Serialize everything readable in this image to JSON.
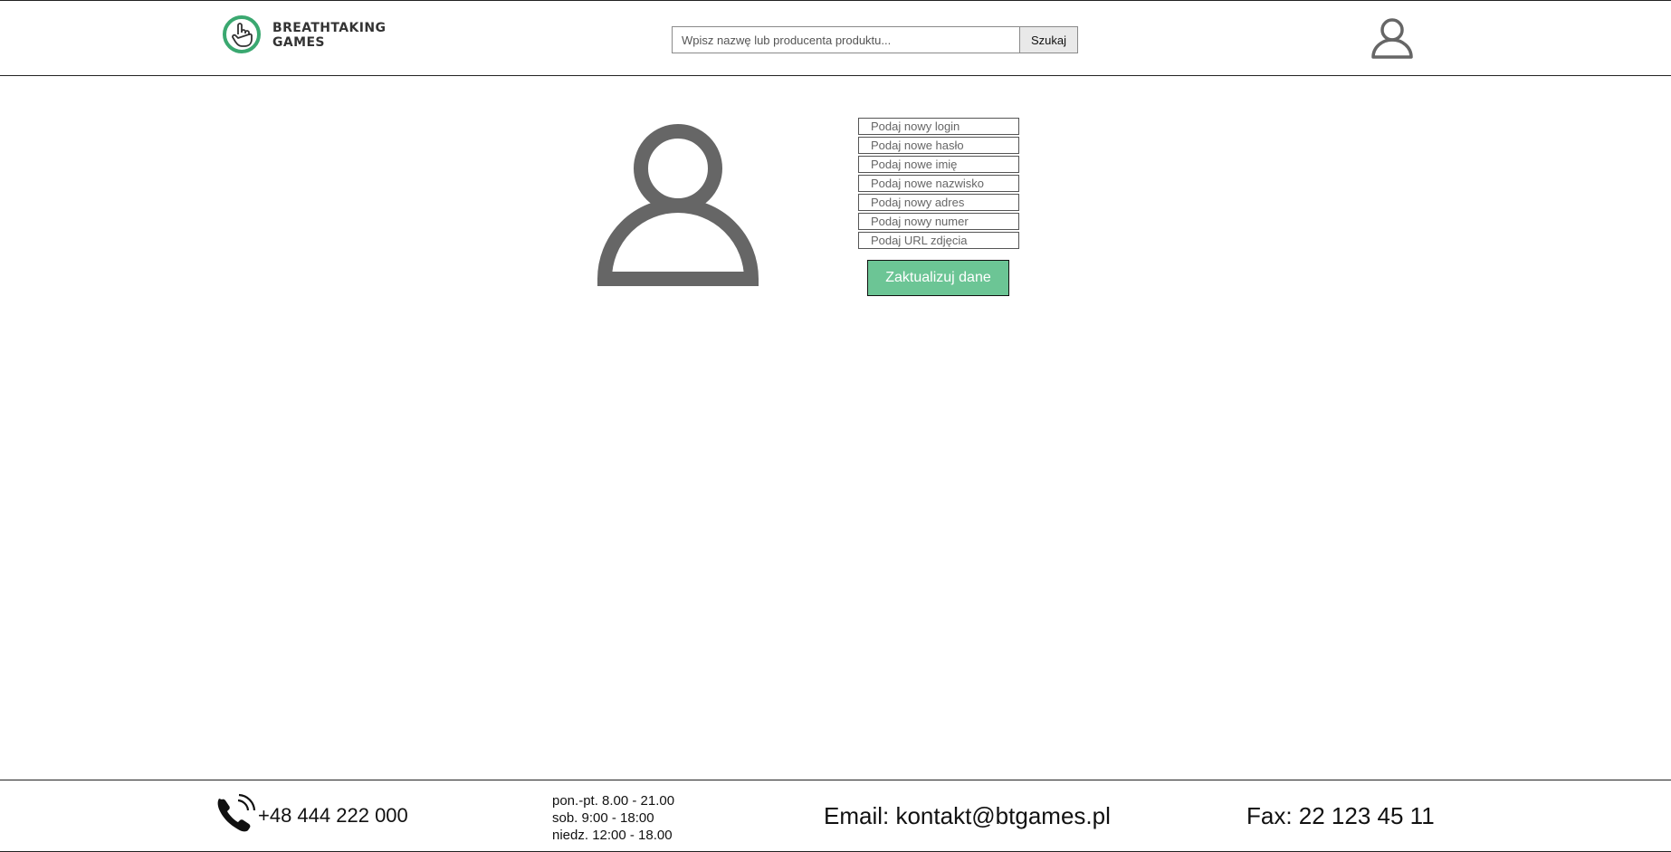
{
  "header": {
    "logo": {
      "line1": "BREATHTAKING",
      "line2": "GAMES"
    },
    "search": {
      "placeholder": "Wpisz nazwę lub producenta produktu...",
      "button_label": "Szukaj"
    }
  },
  "profile": {
    "fields": [
      {
        "placeholder": "Podaj nowy login"
      },
      {
        "placeholder": "Podaj nowe hasło"
      },
      {
        "placeholder": "Podaj nowe imię"
      },
      {
        "placeholder": "Podaj nowe nazwisko"
      },
      {
        "placeholder": "Podaj nowy adres"
      },
      {
        "placeholder": "Podaj nowy numer"
      },
      {
        "placeholder": "Podaj URL zdjęcia"
      }
    ],
    "submit_label": "Zaktualizuj dane"
  },
  "footer": {
    "phone": "+48 444 222 000",
    "hours": [
      "pon.-pt. 8.00 - 21.00",
      "sob. 9:00 - 18:00",
      "niedz. 12:00 - 18.00"
    ],
    "email": "Email: kontakt@btgames.pl",
    "fax": "Fax: 22 123 45 11"
  },
  "colors": {
    "accent": "#6cc595",
    "logo_ring": "#3aa870",
    "avatar": "#666666"
  },
  "icons": {
    "logo": "hand-pointer-icon",
    "account": "user-icon",
    "avatar": "user-avatar-icon",
    "phone": "phone-icon"
  }
}
